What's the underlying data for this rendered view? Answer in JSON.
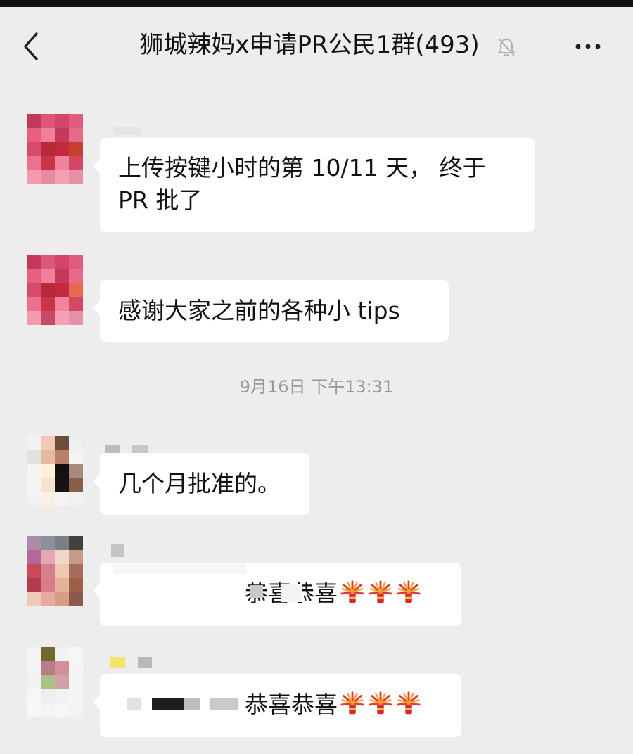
{
  "header": {
    "title": "狮城辣妈x申请PR公民1群(493)",
    "back_icon": "chevron-left-icon",
    "mute_icon": "bell-muted-icon",
    "more_icon": "more-dots-icon"
  },
  "messages": [
    {
      "text": "上传按键小时的第 10/11 天， 终于",
      "text2": "PR 批了"
    },
    {
      "text": "感谢大家之前的各种小 tips"
    },
    {
      "timestamp": "9月16日 下午13:31"
    },
    {
      "text": "几个月批准的。"
    },
    {
      "text": "恭喜恭喜",
      "emoji": "firework-icon"
    },
    {
      "text": "恭喜恭喜",
      "emoji": "firework-icon"
    }
  ],
  "colors": {
    "background": "#ededed",
    "bubble": "#ffffff",
    "timestamp": "#9a9a9a"
  }
}
